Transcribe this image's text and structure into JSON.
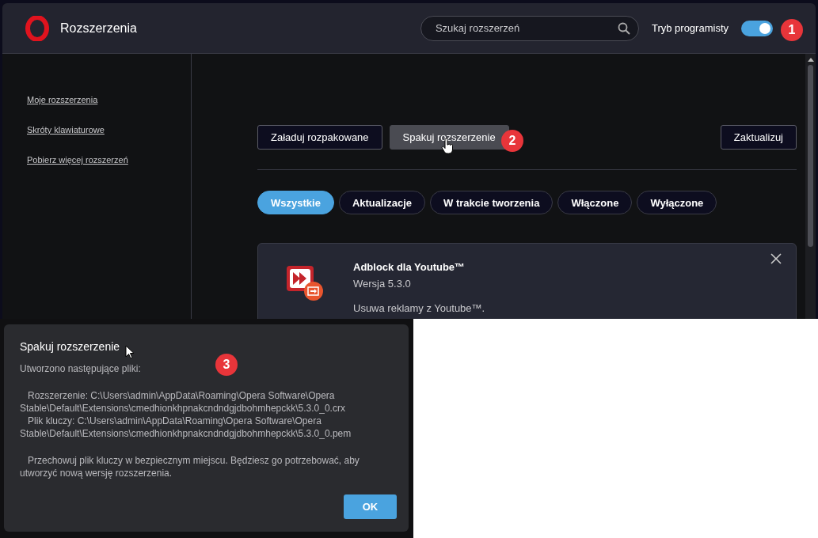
{
  "header": {
    "title": "Rozszerzenia",
    "search": {
      "placeholder": "Szukaj rozszerzeń"
    },
    "dev_mode": {
      "label": "Tryb programisty",
      "on": true
    }
  },
  "sidebar": {
    "items": [
      {
        "label": "Moje rozszerzenia"
      },
      {
        "label": "Skróty klawiaturowe"
      },
      {
        "label": "Pobierz więcej rozszerzeń"
      }
    ]
  },
  "toolbar": {
    "buttons": [
      {
        "label": "Załaduj rozpakowane",
        "hovered": false
      },
      {
        "label": "Spakuj rozszerzenie",
        "hovered": true
      }
    ],
    "update_button": "Zaktualizuj"
  },
  "filters": [
    {
      "label": "Wszystkie",
      "selected": true
    },
    {
      "label": "Aktualizacje",
      "selected": false
    },
    {
      "label": "W trakcie tworzenia",
      "selected": false
    },
    {
      "label": "Włączone",
      "selected": false
    },
    {
      "label": "Wyłączone",
      "selected": false
    }
  ],
  "extension": {
    "name": "Adblock dla Youtube™",
    "version": "Wersja 5.3.0",
    "description": "Usuwa reklamy z Youtube™."
  },
  "dialog": {
    "title": "Spakuj rozszerzenie",
    "intro": "Utworzono następujące pliki:",
    "files": [
      "Rozszerzenie: C:\\Users\\admin\\AppData\\Roaming\\Opera Software\\Opera Stable\\Default\\Extensions\\cmedhionkhpnakcndndgjdbohmhepckk\\5.3.0_0.crx",
      "Plik kluczy: C:\\Users\\admin\\AppData\\Roaming\\Opera Software\\Opera Stable\\Default\\Extensions\\cmedhionkhpnakcndndgjdbohmhepckk\\5.3.0_0.pem"
    ],
    "note": "Przechowuj plik kluczy w bezpiecznym miejscu. Będziesz go potrzebować, aby utworzyć nową wersję rozszerzenia.",
    "ok_button": "OK"
  },
  "annotations": [
    "1",
    "2",
    "3"
  ]
}
